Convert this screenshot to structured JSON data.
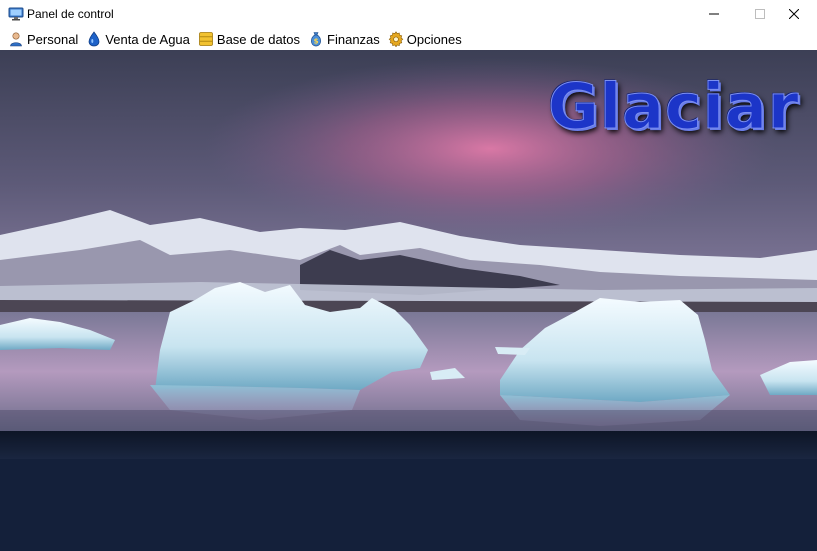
{
  "window": {
    "title": "Panel de control",
    "controls": {
      "minimize": "minimize-icon",
      "maximize": "maximize-icon",
      "close": "close-icon"
    }
  },
  "menu": {
    "items": [
      {
        "label": "Personal",
        "icon": "user-icon"
      },
      {
        "label": "Venta de Agua",
        "icon": "water-drop-icon"
      },
      {
        "label": "Base de datos",
        "icon": "database-icon"
      },
      {
        "label": "Finanzas",
        "icon": "money-bag-icon"
      },
      {
        "label": "Opciones",
        "icon": "gear-icon"
      }
    ]
  },
  "banner": {
    "logo_text": "Glaciar",
    "image": "glacier-lagoon-landscape"
  },
  "colors": {
    "content_background": "#14203a",
    "logo_color": "#1c35c8"
  }
}
